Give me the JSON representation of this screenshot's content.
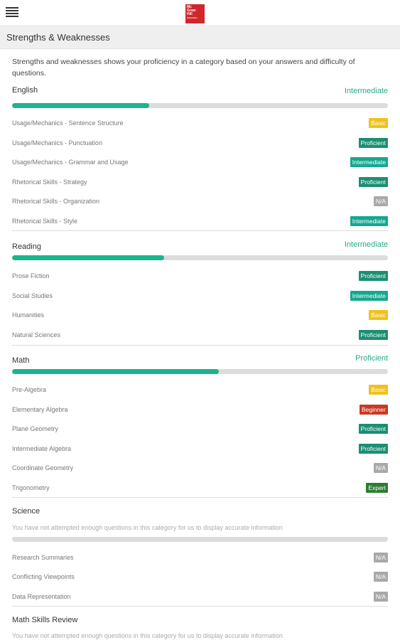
{
  "header": {
    "menu_icon": "list-menu-icon",
    "logo_lines": [
      "Mc",
      "Graw",
      "Hill",
      "Education"
    ]
  },
  "page_title": "Strengths & Weaknesses",
  "intro": "Strengths and weaknesses shows your proficiency in a category based on your answers and difficulty of questions.",
  "colors": {
    "accent": "#1db38e",
    "basic": "#f0c21f",
    "proficient": "#1a8f72",
    "intermediate": "#15a88f",
    "na": "#a9a9a9",
    "beginner": "#c83a23",
    "expert": "#2e7d32"
  },
  "categories": [
    {
      "name": "English",
      "level": "Intermediate",
      "progress_fraction": 0.365,
      "subcategories": [
        {
          "label": "Usage/Mechanics - Sentence Structure",
          "badge": "Basic"
        },
        {
          "label": "Usage/Mechanics - Punctuation",
          "badge": "Proficient"
        },
        {
          "label": "Usage/Mechanics - Grammar and Usage",
          "badge": "Intermediate"
        },
        {
          "label": "Rhetorical Skills - Strategy",
          "badge": "Proficient"
        },
        {
          "label": "Rhetorical Skills - Organization",
          "badge": "N/A"
        },
        {
          "label": "Rhetorical Skills - Style",
          "badge": "Intermediate"
        }
      ]
    },
    {
      "name": "Reading",
      "level": "Intermediate",
      "progress_fraction": 0.405,
      "subcategories": [
        {
          "label": "Prose Fiction",
          "badge": "Proficient"
        },
        {
          "label": "Social Studies",
          "badge": "Intermediate"
        },
        {
          "label": "Humanities",
          "badge": "Basic"
        },
        {
          "label": "Natural Sciences",
          "badge": "Proficient"
        }
      ]
    },
    {
      "name": "Math",
      "level": "Proficient",
      "progress_fraction": 0.55,
      "subcategories": [
        {
          "label": "Pre-Algebra",
          "badge": "Basic"
        },
        {
          "label": "Elementary Algebra",
          "badge": "Beginner"
        },
        {
          "label": "Plane Geometry",
          "badge": "Proficient"
        },
        {
          "label": "Intermediate Algebra",
          "badge": "Proficient"
        },
        {
          "label": "Coordinate Geometry",
          "badge": "N/A"
        },
        {
          "label": "Trigonometry",
          "badge": "Expert"
        }
      ]
    },
    {
      "name": "Science",
      "notice": "You have not attempted enough questions in this category for us to display accurate information",
      "progress_fraction": 0,
      "subcategories": [
        {
          "label": "Research Summaries",
          "badge": "N/A"
        },
        {
          "label": "Conflicting Viewpoints",
          "badge": "N/A"
        },
        {
          "label": "Data Representation",
          "badge": "N/A"
        }
      ]
    },
    {
      "name": "Math Skills Review",
      "notice": "You have not attempted enough questions in this category for us to display accurate information"
    }
  ]
}
